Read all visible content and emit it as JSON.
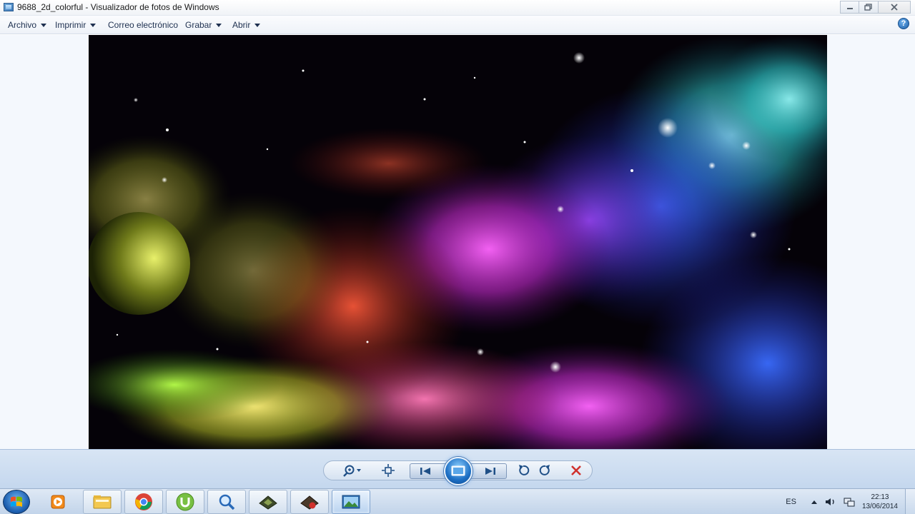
{
  "window": {
    "title": "9688_2d_colorful - Visualizador de fotos de Windows",
    "app_icon": "photo-viewer-icon",
    "controls": [
      "minimize-icon",
      "maximize-icon",
      "close-icon"
    ]
  },
  "menubar": {
    "items": [
      {
        "label": "Archivo",
        "has_dropdown": true
      },
      {
        "label": "Imprimir",
        "has_dropdown": true
      },
      {
        "label": "Correo electrónico",
        "has_dropdown": false
      },
      {
        "label": "Grabar",
        "has_dropdown": true
      },
      {
        "label": "Abrir",
        "has_dropdown": true
      }
    ],
    "help_label": "?"
  },
  "image": {
    "description_icon": "colorful-nebula-photo"
  },
  "controls": {
    "buttons": [
      "zoom-icon",
      "actual-size-icon",
      "previous-icon",
      "slideshow-icon",
      "next-icon",
      "rotate-left-icon",
      "rotate-right-icon",
      "delete-icon"
    ]
  },
  "taskbar": {
    "pinned": [
      "media-player-icon",
      "file-explorer-icon",
      "chrome-icon",
      "utorrent-icon",
      "search-tool-icon",
      "app-icon-1",
      "app-icon-2",
      "photo-viewer-icon"
    ],
    "tray": {
      "language": "ES",
      "time": "22:13",
      "date": "13/06/2014"
    }
  },
  "colors": {
    "accent": "#1d6fc4",
    "delete": "#d0312d",
    "viewer_bg": "#f4f8fd"
  }
}
